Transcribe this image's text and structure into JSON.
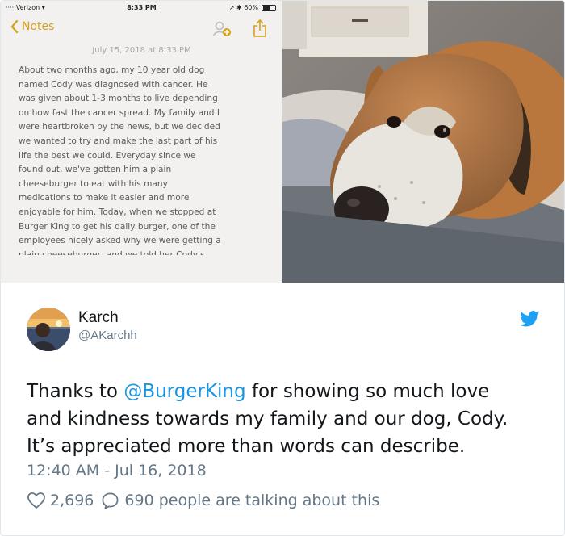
{
  "colors": {
    "notes_accent": "#d6a21e",
    "twitter_blue": "#1da1f2",
    "mention_blue": "#1b95e0",
    "secondary_text": "#657786",
    "primary_text": "#14171a"
  },
  "phone_screenshot": {
    "status_bar": {
      "carrier": "Verizon",
      "time": "8:33 PM",
      "battery": "60%"
    },
    "nav": {
      "back_label": "Notes",
      "icons": [
        "chevron-left-icon",
        "add-person-icon",
        "share-upload-icon"
      ]
    },
    "note_date": "July 15, 2018 at 8:33 PM",
    "note_lines": [
      "About two months ago, my 10 year old dog",
      "named Cody was diagnosed with cancer. He",
      "was given about 1-3 months to live depending",
      "on how fast the cancer spread. My family and I",
      "were heartbroken by the news, but we decided",
      "we wanted to try and make the last part of his",
      "life the best we could. Everyday since we",
      "found out, we've gotten him a plain",
      "cheeseburger to eat with his many",
      "medications to make it easier and more",
      "enjoyable for him. Today, when we stopped at",
      "Burger King to get his daily burger, one of the",
      "employees nicely asked why we were getting a",
      "plain cheeseburger, and we told her Cody's"
    ]
  },
  "tweet": {
    "user": {
      "name": "Karch",
      "handle": "@AKarchh"
    },
    "text_lines": [
      {
        "before": "Thanks to ",
        "mention": "@BurgerKing",
        "after": " for showing so much love"
      },
      {
        "text": "and kindness towards my family and our dog, Cody."
      },
      {
        "text": "It’s appreciated more than words can describe."
      }
    ],
    "timestamp": "12:40 AM - Jul 16, 2018",
    "like_count": "2,696",
    "talking_text": "690 people are talking about this"
  }
}
